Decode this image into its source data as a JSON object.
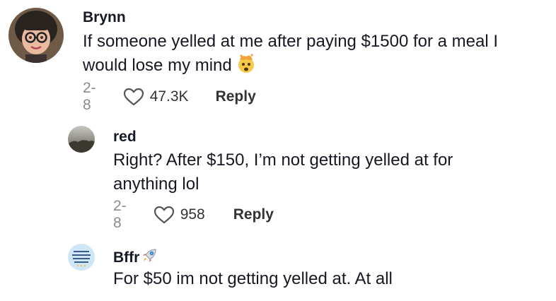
{
  "comments": [
    {
      "username": "Brynn",
      "text_line1": "If someone yelled at me after paying $1500 for a meal I",
      "text_line2": "would lose my mind",
      "emoji_icon": "exploding-head-icon",
      "date": "2-8",
      "likes": "47.3K",
      "reply_label": "Reply"
    },
    {
      "username": "red",
      "text_line1": "Right? After $150, I’m not getting yelled at for",
      "text_line2": "anything lol",
      "date": "2-8",
      "likes": "958",
      "reply_label": "Reply"
    },
    {
      "username": "Bffr",
      "username_emoji_icon": "rocket-icon",
      "text_line1": "For $50 im not getting yelled at. At all"
    }
  ],
  "colors": {
    "text": "#161823",
    "meta": "#8a8b91",
    "action": "#333333"
  }
}
